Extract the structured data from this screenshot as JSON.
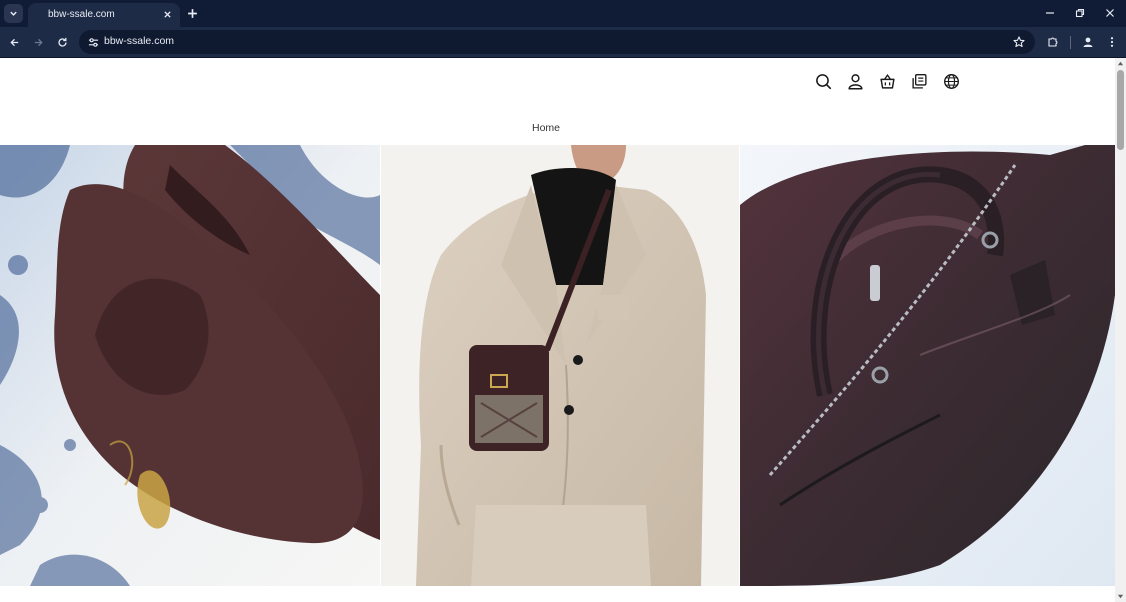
{
  "browser": {
    "tab": {
      "title": "bbw-ssale.com"
    },
    "address_bar": {
      "url": "bbw-ssale.com"
    }
  },
  "site": {
    "header_icons": [
      "search-icon",
      "account-icon",
      "cart-icon",
      "catalog-icon",
      "globe-icon"
    ],
    "nav": {
      "home_label": "Home"
    },
    "hero_panels": [
      "suede-loafers-image",
      "beige-suit-crossbody-bag-image",
      "leather-duffle-bag-image"
    ]
  },
  "colors": {
    "chrome_dark": "#101c35",
    "chrome_toolbar": "#1e2b46",
    "page_background": "#ffffff",
    "text": "#333333"
  }
}
